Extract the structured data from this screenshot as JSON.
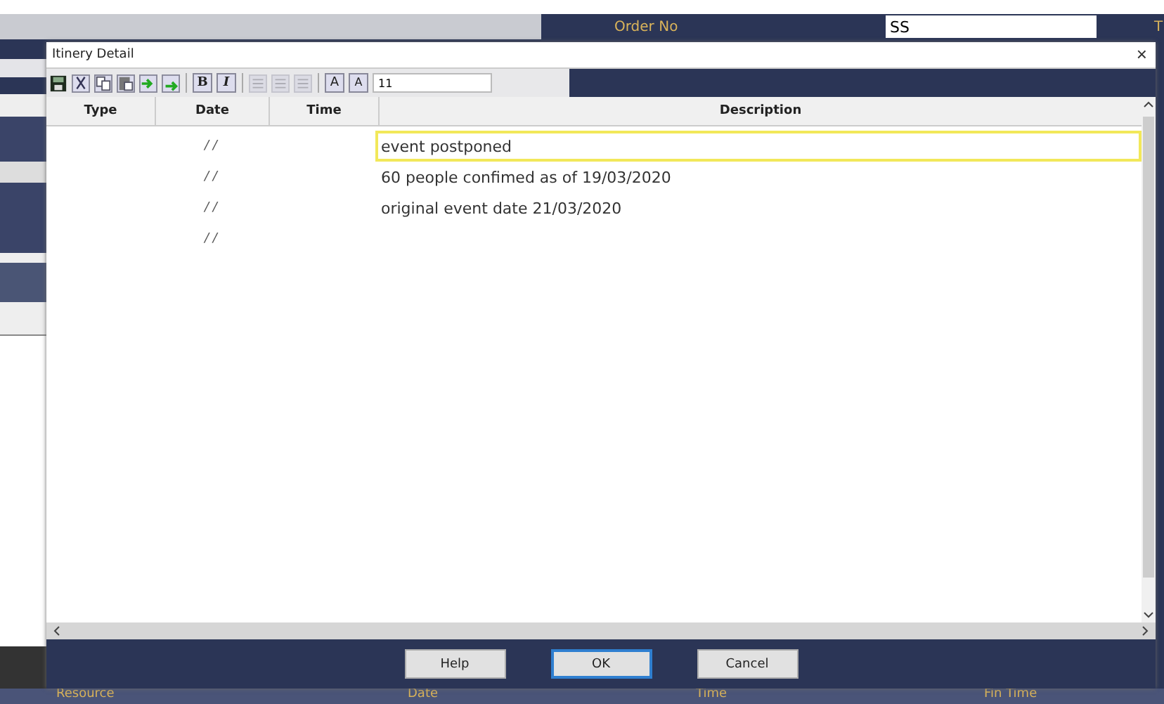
{
  "background": {
    "order_label": "Order No",
    "order_value": "SS",
    "cut_label": "T",
    "columns": [
      "Resource",
      "Date",
      "Time",
      "Fin Time"
    ]
  },
  "dialog": {
    "title": "Itinery Detail",
    "close": "×"
  },
  "toolbar": {
    "format_buttons": [
      {
        "label": "B",
        "kind": "bold"
      },
      {
        "label": "I",
        "kind": "italic"
      }
    ],
    "align_disabled": true,
    "size_buttons": [
      {
        "label": "A",
        "kind": "grow"
      },
      {
        "label": "A",
        "kind": "shrink"
      }
    ],
    "font_size": "11"
  },
  "table": {
    "columns": [
      "Type",
      "Date",
      "Time",
      "Description"
    ],
    "rows": [
      {
        "date": "/ /",
        "description": "event postponed",
        "selected": true
      },
      {
        "date": "/ /",
        "description": "60 people confimed as of 19/03/2020",
        "selected": false
      },
      {
        "date": "/ /",
        "description": "original event date 21/03/2020",
        "selected": false
      },
      {
        "date": "/ /",
        "selected": false
      }
    ]
  },
  "buttons": [
    {
      "label": "Help",
      "default": false
    },
    {
      "label": "OK",
      "default": true
    },
    {
      "label": "Cancel",
      "default": false
    }
  ]
}
